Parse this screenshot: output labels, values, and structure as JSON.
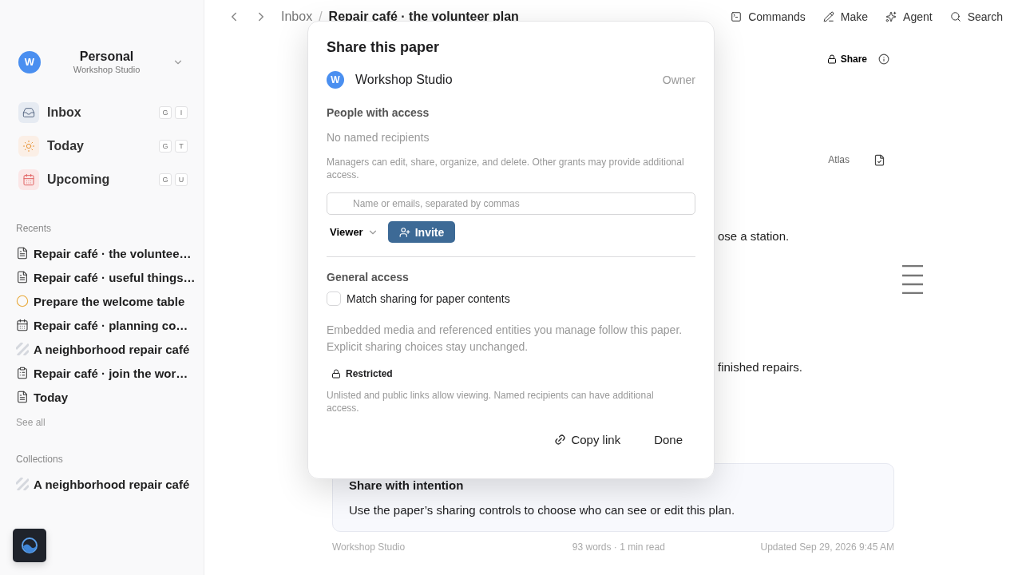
{
  "sidebar": {
    "workspace": {
      "avatar": "W",
      "name": "Personal",
      "subtitle": "Workshop Studio"
    },
    "nav": [
      {
        "label": "Inbox",
        "kind": "inbox",
        "keys": [
          "G",
          "I"
        ]
      },
      {
        "label": "Today",
        "kind": "today",
        "keys": [
          "G",
          "T"
        ]
      },
      {
        "label": "Upcoming",
        "kind": "upcoming",
        "keys": [
          "G",
          "U"
        ]
      }
    ],
    "recents_title": "Recents",
    "recents": [
      {
        "label": "Repair café · the voluntee…",
        "kind": "doc"
      },
      {
        "label": "Repair café · useful things…",
        "kind": "doc"
      },
      {
        "label": "Prepare the welcome table",
        "kind": "task"
      },
      {
        "label": "Repair café · planning co…",
        "kind": "calendar"
      },
      {
        "label": "A neighborhood repair café",
        "kind": "collection"
      },
      {
        "label": "Repair café · join the wor…",
        "kind": "clipboard"
      },
      {
        "label": "Today",
        "kind": "doc"
      }
    ],
    "see_all": "See all",
    "collections_title": "Collections",
    "collections": [
      {
        "label": "A neighborhood repair café",
        "kind": "collection"
      }
    ]
  },
  "toolbar": {
    "breadcrumb": [
      "Inbox",
      "Repair café · the volunteer plan"
    ],
    "separator": "/",
    "actions": [
      {
        "label": "Commands",
        "kind": "commands"
      },
      {
        "label": "Make",
        "kind": "make"
      },
      {
        "label": "Agent",
        "kind": "agent"
      },
      {
        "label": "Search",
        "kind": "search"
      }
    ]
  },
  "document": {
    "share_label": "Share",
    "author_tag": "Atlas",
    "line_1": "ose a station.",
    "line_2": "finished repairs.",
    "callout": {
      "title": "Share with intention",
      "body": "Use the paper’s sharing controls to choose who can see or edit this plan."
    },
    "footer": {
      "workspace": "Workshop Studio",
      "stats": "93 words · 1 min read",
      "updated": "Updated Sep 29, 2026 9:45 AM"
    }
  },
  "share_dialog": {
    "title": "Share this paper",
    "owner": {
      "avatar": "W",
      "name": "Workshop Studio",
      "role": "Owner"
    },
    "people_title": "People with access",
    "people_empty": "No named recipients",
    "managers_note": "Managers can edit, share, organize, and delete. Other grants may provide additional access.",
    "invite_field": {
      "placeholder": "Name or emails, separated by commas"
    },
    "role": "Viewer",
    "invite_button": "Invite",
    "general_title": "General access",
    "match_sharing": {
      "label": "Match sharing for paper contents",
      "checked": false
    },
    "embedded_note": "Embedded media and referenced entities you manage follow this paper. Explicit sharing choices stay unchanged.",
    "access_level": "Restricted",
    "links_note": "Unlisted and public links allow viewing. Named recipients can have additional access.",
    "buttons": [
      "Copy link",
      "Done"
    ]
  }
}
